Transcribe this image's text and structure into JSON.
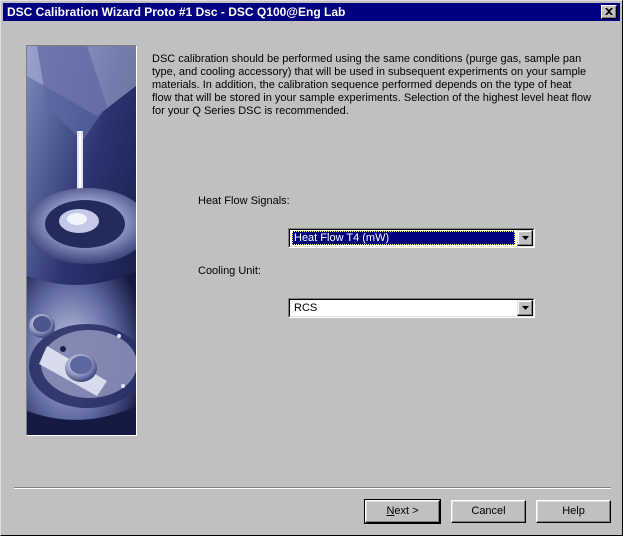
{
  "window": {
    "title": "DSC Calibration Wizard Proto #1 Dsc - DSC Q100@Eng Lab",
    "close_icon": "close-x-icon"
  },
  "content": {
    "intro_text": "DSC calibration should be performed using the same conditions (purge gas, sample pan type, and cooling accessory) that will be used in subsequent experiments on your sample materials. In addition, the calibration sequence performed depends on the type of heat flow that will be stored in your sample experiments.  Selection of the highest level heat flow for your Q Series DSC is recommended.",
    "heat_flow_label": "Heat Flow Signals:",
    "heat_flow_value": "Heat Flow T4 (mW)",
    "cooling_label": "Cooling Unit:",
    "cooling_value": "RCS"
  },
  "buttons": {
    "next_prefix": "N",
    "next_rest": "ext >",
    "cancel": "Cancel",
    "help": "Help"
  },
  "colors": {
    "titlebar": "#000080",
    "face": "#c0c0c0",
    "selection": "#000080"
  }
}
